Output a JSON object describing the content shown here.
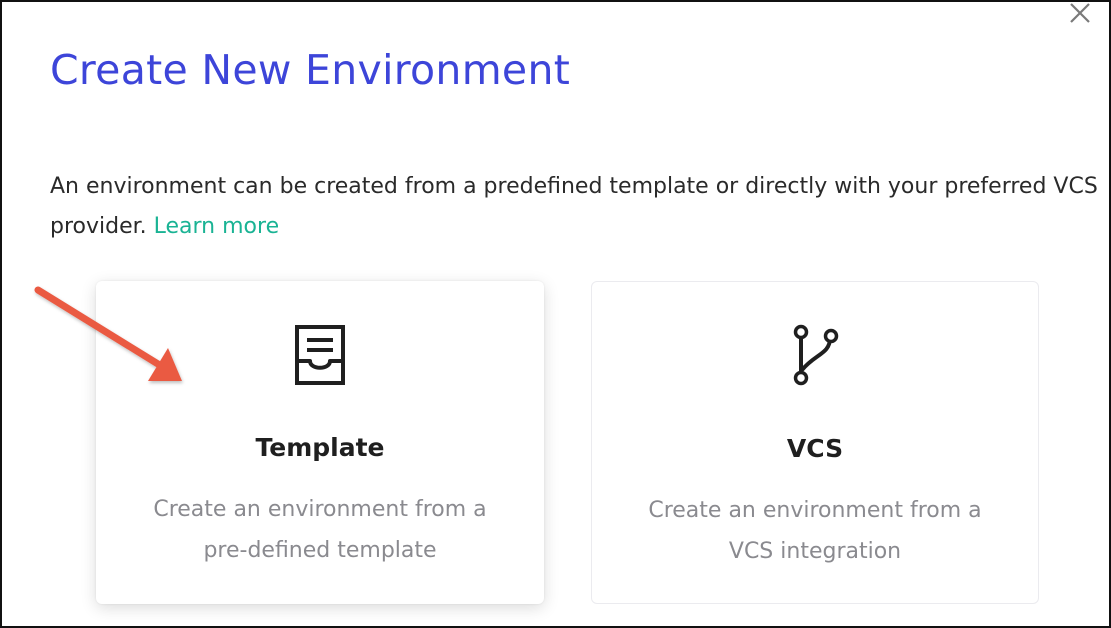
{
  "modal": {
    "title": "Create New Environment",
    "description": "An environment can be created from a predefined template or directly with your preferred VCS provider.",
    "learn_more": "Learn more",
    "close_icon": "close-icon"
  },
  "cards": [
    {
      "icon": "template-icon",
      "title": "Template",
      "description": "Create an environment from a pre-defined template"
    },
    {
      "icon": "git-branch-icon",
      "title": "VCS",
      "description": "Create an environment from a VCS integration"
    }
  ],
  "colors": {
    "title": "#3d45d9",
    "link": "#1ab394",
    "annotation_arrow": "#ea5a43",
    "muted_text": "#8a8a8f"
  }
}
